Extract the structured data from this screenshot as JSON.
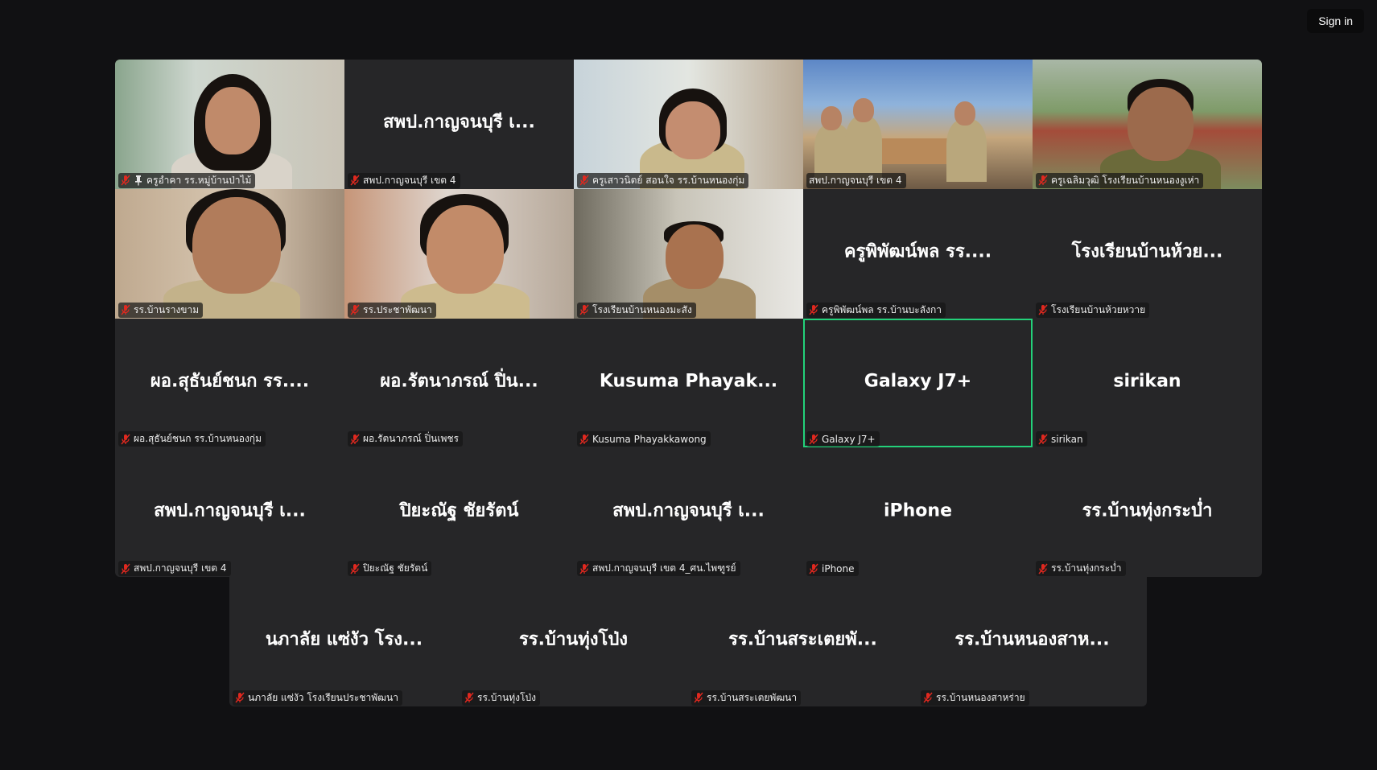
{
  "header": {
    "sign_in_label": "Sign in"
  },
  "colors": {
    "background": "#111113",
    "tile": "#262628",
    "active_border": "#23d17a",
    "mic_muted": "#e0281f"
  },
  "participants": [
    {
      "display": "",
      "label": "ครูอำคา รร.หมู่บ้านป่าไม้",
      "video": true,
      "pinned": true
    },
    {
      "display": "สพป.กาญจนบุรี เ...",
      "label": "สพป.กาญจนบุรี เขต 4",
      "video": false
    },
    {
      "display": "",
      "label": "ครูเสาวนิตย์ สอนใจ รร.บ้านหนองกุ่ม",
      "video": true
    },
    {
      "display": "",
      "label": "สพป.กาญจนบุรี เขต 4",
      "video": true
    },
    {
      "display": "",
      "label": "ครูเฉลิมวุฒิ โรงเรียนบ้านหนองงูเห่า",
      "video": true
    },
    {
      "display": "",
      "label": "รร.บ้านรางขาม",
      "video": true
    },
    {
      "display": "",
      "label": "รร.ประชาพัฒนา",
      "video": true
    },
    {
      "display": "",
      "label": "โรงเรียนบ้านหนองมะสัง",
      "video": true
    },
    {
      "display": "ครูพิพัฒน์พล รร....",
      "label": "ครูพิพัฒน์พล รร.บ้านบะลังกา",
      "video": false
    },
    {
      "display": "โรงเรียนบ้านห้วย...",
      "label": "โรงเรียนบ้านห้วยหวาย",
      "video": false
    },
    {
      "display": "ผอ.สุธันย์ชนก รร....",
      "label": "ผอ.สุธันย์ชนก รร.บ้านหนองกุ่ม",
      "video": false
    },
    {
      "display": "ผอ.รัตนาภรณ์ ปิ่น...",
      "label": "ผอ.รัตนาภรณ์ ปิ่นเพชร",
      "video": false
    },
    {
      "display": "Kusuma Phayak...",
      "label": "Kusuma Phayakkawong",
      "video": false
    },
    {
      "display": "Galaxy J7+",
      "label": "Galaxy J7+",
      "video": false,
      "active": true
    },
    {
      "display": "sirikan",
      "label": "sirikan",
      "video": false
    },
    {
      "display": "สพป.กาญจนบุรี เ...",
      "label": "สพป.กาญจนบุรี เขต 4",
      "video": false
    },
    {
      "display": "ปิยะณัฐ ชัยรัตน์",
      "label": "ปิยะณัฐ ชัยรัตน์",
      "video": false
    },
    {
      "display": "สพป.กาญจนบุรี เ...",
      "label": "สพป.กาญจนบุรี เขต 4_ศน.ไพฑูรย์",
      "video": false
    },
    {
      "display": "iPhone",
      "label": "iPhone",
      "video": false
    },
    {
      "display": "รร.บ้านทุ่งกระบ่ำ",
      "label": "รร.บ้านทุ่งกระบ่ำ",
      "video": false
    },
    {
      "display": "นภาลัย แซ่งัว โรง...",
      "label": "นภาลัย แซ่งัว โรงเรียนประชาพัฒนา",
      "video": false
    },
    {
      "display": "รร.บ้านทุ่งโป่ง",
      "label": "รร.บ้านทุ่งโป่ง",
      "video": false
    },
    {
      "display": "รร.บ้านสระเตยพั...",
      "label": "รร.บ้านสระเตยพัฒนา",
      "video": false
    },
    {
      "display": "รร.บ้านหนองสาห...",
      "label": "รร.บ้านหนองสาหร่าย",
      "video": false
    }
  ]
}
